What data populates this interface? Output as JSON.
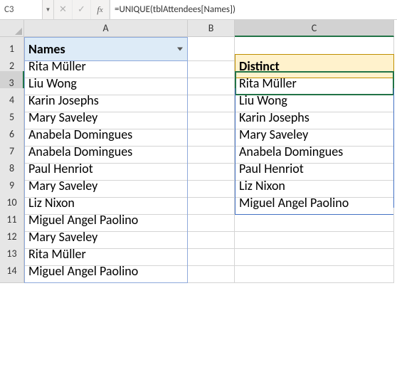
{
  "formula_bar": {
    "name_box": "C3",
    "formula": "=UNIQUE(tblAttendees[Names])"
  },
  "columns": {
    "a": "A",
    "b": "B",
    "c": "C"
  },
  "rows": {
    "r1": "1",
    "r2": "2",
    "r3": "3",
    "r4": "4",
    "r5": "5",
    "r6": "6",
    "r7": "7",
    "r8": "8",
    "r9": "9",
    "r10": "10",
    "r11": "11",
    "r12": "12",
    "r13": "13",
    "r14": "14"
  },
  "table_a": {
    "header": "Names",
    "data": [
      "Rita Müller",
      "Liu Wong",
      "Karin Josephs",
      "Mary Saveley",
      "Anabela Domingues",
      "Anabela Domingues",
      "Paul Henriot",
      "Mary Saveley",
      "Liz Nixon",
      "Miguel Angel Paolino",
      "Mary Saveley",
      "Rita Müller",
      "Miguel Angel Paolino"
    ]
  },
  "table_c": {
    "header": "Distinct",
    "data": [
      "Rita Müller",
      "Liu Wong",
      "Karin Josephs",
      "Mary Saveley",
      "Anabela Domingues",
      "Paul Henriot",
      "Liz Nixon",
      "Miguel Angel Paolino"
    ]
  }
}
